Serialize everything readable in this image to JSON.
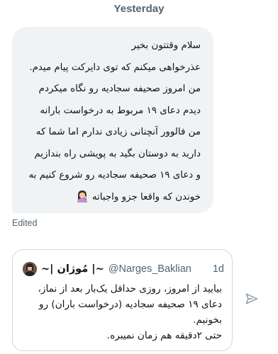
{
  "conversation": {
    "day_label": "Yesterday",
    "edited_label": "Edited"
  },
  "message": {
    "lines": [
      "سلام وقتتون بخیر",
      "عذرخواهی میکنم که توی دایرکت پیام میدم.",
      "من امروز صحیفه سجادیه رو نگاه میکردم",
      "دیدم دعای ۱۹ مربوط به درخواست بارانه",
      "من فالوور آنچنانی زیادی ندارم اما شما که",
      "دارید به دوستان بگید به پویشی راه بندازیم",
      "و دعای ۱۹ صحیفه سجادیه رو شروع کنیم به",
      "خوندن که واقعا جزو واجباته"
    ],
    "emoji_icon": "woman-tipping-hand-emoji"
  },
  "quoted_post": {
    "author_name": "~| مُوژان |~",
    "handle": "@Narges_Baklian",
    "time": "1d",
    "lines": [
      "بیایید از امروز، روزی حداقل یک‌بار بعد از نماز،",
      "دعای ۱۹ صحیفه سجادیه (درخواست باران) رو",
      "بخونیم.",
      "حتی ۲دقیقه هم زمان نمیبره."
    ]
  },
  "icons": {
    "send": "send-icon"
  },
  "colors": {
    "bubble_bg": "#eff3f4",
    "muted_text": "#536471",
    "card_border": "#cfd9de"
  }
}
